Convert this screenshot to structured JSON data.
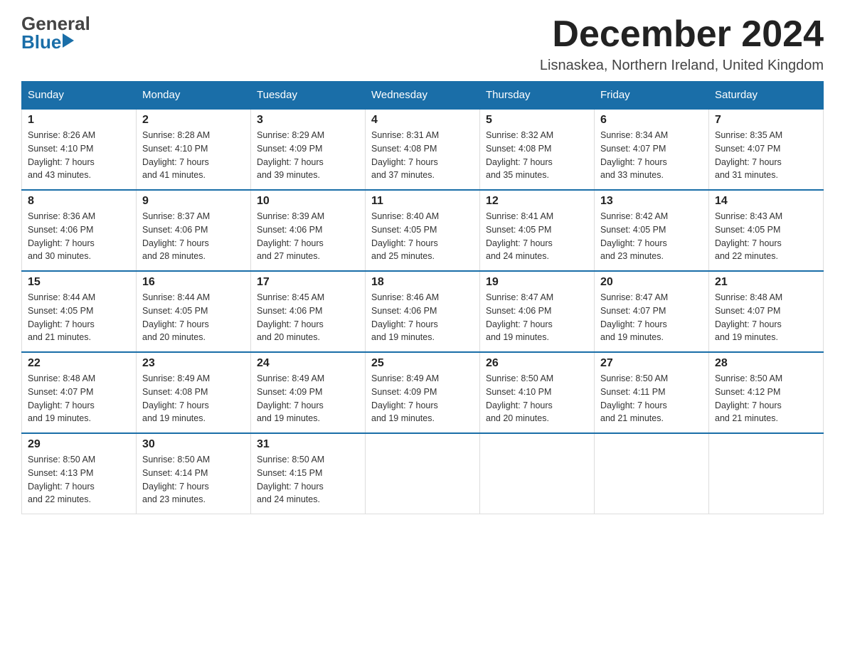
{
  "header": {
    "logo_general": "General",
    "logo_blue": "Blue",
    "month_title": "December 2024",
    "location": "Lisnaskea, Northern Ireland, United Kingdom"
  },
  "days_of_week": [
    "Sunday",
    "Monday",
    "Tuesday",
    "Wednesday",
    "Thursday",
    "Friday",
    "Saturday"
  ],
  "weeks": [
    [
      {
        "day": "1",
        "sunrise": "8:26 AM",
        "sunset": "4:10 PM",
        "daylight": "7 hours and 43 minutes."
      },
      {
        "day": "2",
        "sunrise": "8:28 AM",
        "sunset": "4:10 PM",
        "daylight": "7 hours and 41 minutes."
      },
      {
        "day": "3",
        "sunrise": "8:29 AM",
        "sunset": "4:09 PM",
        "daylight": "7 hours and 39 minutes."
      },
      {
        "day": "4",
        "sunrise": "8:31 AM",
        "sunset": "4:08 PM",
        "daylight": "7 hours and 37 minutes."
      },
      {
        "day": "5",
        "sunrise": "8:32 AM",
        "sunset": "4:08 PM",
        "daylight": "7 hours and 35 minutes."
      },
      {
        "day": "6",
        "sunrise": "8:34 AM",
        "sunset": "4:07 PM",
        "daylight": "7 hours and 33 minutes."
      },
      {
        "day": "7",
        "sunrise": "8:35 AM",
        "sunset": "4:07 PM",
        "daylight": "7 hours and 31 minutes."
      }
    ],
    [
      {
        "day": "8",
        "sunrise": "8:36 AM",
        "sunset": "4:06 PM",
        "daylight": "7 hours and 30 minutes."
      },
      {
        "day": "9",
        "sunrise": "8:37 AM",
        "sunset": "4:06 PM",
        "daylight": "7 hours and 28 minutes."
      },
      {
        "day": "10",
        "sunrise": "8:39 AM",
        "sunset": "4:06 PM",
        "daylight": "7 hours and 27 minutes."
      },
      {
        "day": "11",
        "sunrise": "8:40 AM",
        "sunset": "4:05 PM",
        "daylight": "7 hours and 25 minutes."
      },
      {
        "day": "12",
        "sunrise": "8:41 AM",
        "sunset": "4:05 PM",
        "daylight": "7 hours and 24 minutes."
      },
      {
        "day": "13",
        "sunrise": "8:42 AM",
        "sunset": "4:05 PM",
        "daylight": "7 hours and 23 minutes."
      },
      {
        "day": "14",
        "sunrise": "8:43 AM",
        "sunset": "4:05 PM",
        "daylight": "7 hours and 22 minutes."
      }
    ],
    [
      {
        "day": "15",
        "sunrise": "8:44 AM",
        "sunset": "4:05 PM",
        "daylight": "7 hours and 21 minutes."
      },
      {
        "day": "16",
        "sunrise": "8:44 AM",
        "sunset": "4:05 PM",
        "daylight": "7 hours and 20 minutes."
      },
      {
        "day": "17",
        "sunrise": "8:45 AM",
        "sunset": "4:06 PM",
        "daylight": "7 hours and 20 minutes."
      },
      {
        "day": "18",
        "sunrise": "8:46 AM",
        "sunset": "4:06 PM",
        "daylight": "7 hours and 19 minutes."
      },
      {
        "day": "19",
        "sunrise": "8:47 AM",
        "sunset": "4:06 PM",
        "daylight": "7 hours and 19 minutes."
      },
      {
        "day": "20",
        "sunrise": "8:47 AM",
        "sunset": "4:07 PM",
        "daylight": "7 hours and 19 minutes."
      },
      {
        "day": "21",
        "sunrise": "8:48 AM",
        "sunset": "4:07 PM",
        "daylight": "7 hours and 19 minutes."
      }
    ],
    [
      {
        "day": "22",
        "sunrise": "8:48 AM",
        "sunset": "4:07 PM",
        "daylight": "7 hours and 19 minutes."
      },
      {
        "day": "23",
        "sunrise": "8:49 AM",
        "sunset": "4:08 PM",
        "daylight": "7 hours and 19 minutes."
      },
      {
        "day": "24",
        "sunrise": "8:49 AM",
        "sunset": "4:09 PM",
        "daylight": "7 hours and 19 minutes."
      },
      {
        "day": "25",
        "sunrise": "8:49 AM",
        "sunset": "4:09 PM",
        "daylight": "7 hours and 19 minutes."
      },
      {
        "day": "26",
        "sunrise": "8:50 AM",
        "sunset": "4:10 PM",
        "daylight": "7 hours and 20 minutes."
      },
      {
        "day": "27",
        "sunrise": "8:50 AM",
        "sunset": "4:11 PM",
        "daylight": "7 hours and 21 minutes."
      },
      {
        "day": "28",
        "sunrise": "8:50 AM",
        "sunset": "4:12 PM",
        "daylight": "7 hours and 21 minutes."
      }
    ],
    [
      {
        "day": "29",
        "sunrise": "8:50 AM",
        "sunset": "4:13 PM",
        "daylight": "7 hours and 22 minutes."
      },
      {
        "day": "30",
        "sunrise": "8:50 AM",
        "sunset": "4:14 PM",
        "daylight": "7 hours and 23 minutes."
      },
      {
        "day": "31",
        "sunrise": "8:50 AM",
        "sunset": "4:15 PM",
        "daylight": "7 hours and 24 minutes."
      },
      null,
      null,
      null,
      null
    ]
  ],
  "labels": {
    "sunrise": "Sunrise:",
    "sunset": "Sunset:",
    "daylight": "Daylight:"
  }
}
